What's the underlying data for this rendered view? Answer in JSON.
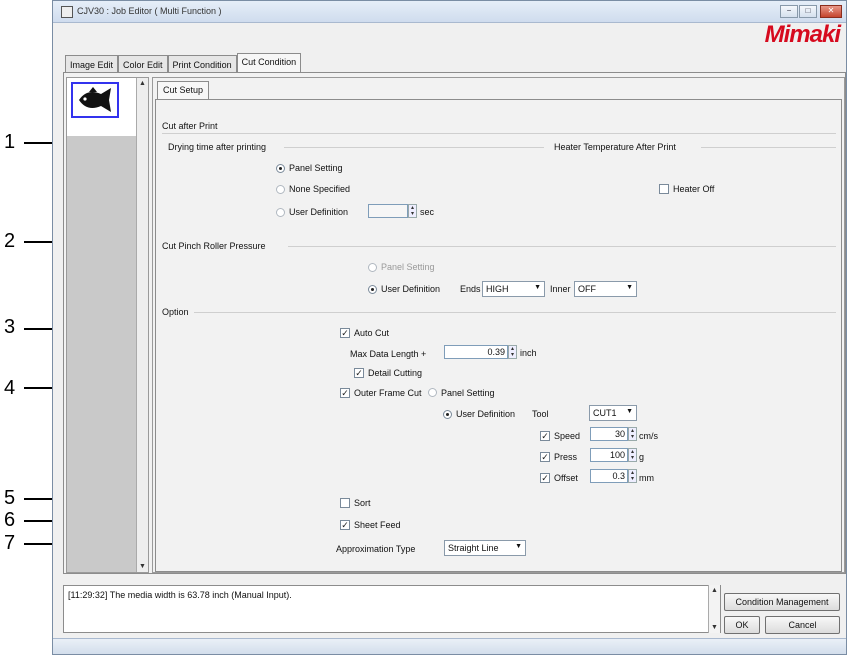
{
  "window": {
    "title": "CJV30 : Job Editor ( Multi Function )",
    "brand": "Mimaki",
    "controls": [
      "−",
      "□",
      "✕"
    ]
  },
  "tabs": [
    {
      "label": "Image Edit"
    },
    {
      "label": "Color Edit"
    },
    {
      "label": "Print Condition"
    },
    {
      "label": "Cut Condition",
      "active": true
    }
  ],
  "subtab": {
    "label": "Cut Setup"
  },
  "cut_after_print": {
    "heading": "Cut after Print",
    "drying_time_label": "Drying time after printing",
    "heater_label": "Heater Temperature After Print",
    "options": {
      "panel_setting": "Panel Setting",
      "none_specified": "None Specified",
      "user_definition": "User Definition"
    },
    "selected": "panel_setting",
    "sec_unit": "sec",
    "heater_off_label": "Heater Off",
    "heater_off_checked": false
  },
  "pinch_roller": {
    "heading": "Cut Pinch Roller Pressure",
    "panel_setting": "Panel Setting",
    "user_definition": "User Definition",
    "selected": "user_definition",
    "ends_label": "Ends",
    "ends_value": "HIGH",
    "inner_label": "Inner",
    "inner_value": "OFF"
  },
  "option": {
    "heading": "Option",
    "auto_cut": {
      "label": "Auto Cut",
      "checked": true
    },
    "max_data_length": {
      "label": "Max Data Length +",
      "value": "0.39",
      "unit": "inch"
    },
    "detail_cutting": {
      "label": "Detail Cutting",
      "checked": true
    },
    "outer_frame_cut": {
      "label": "Outer Frame Cut",
      "checked": true
    },
    "outer_panel_setting": "Panel Setting",
    "outer_user_definition": "User Definition",
    "outer_selected": "user_definition",
    "tool_label": "Tool",
    "tool_value": "CUT1",
    "speed": {
      "label": "Speed",
      "value": "30",
      "unit": "cm/s",
      "checked": true
    },
    "press": {
      "label": "Press",
      "value": "100",
      "unit": "g",
      "checked": true
    },
    "offset": {
      "label": "Offset",
      "value": "0.3",
      "unit": "mm",
      "checked": true
    },
    "sort": {
      "label": "Sort",
      "checked": false
    },
    "sheet_feed": {
      "label": "Sheet Feed",
      "checked": true
    },
    "approximation_label": "Approximation Type",
    "approximation_value": "Straight Line"
  },
  "log": {
    "message": "[11:29:32] The media width is 63.78 inch (Manual Input)."
  },
  "buttons": {
    "condition_management": "Condition Management",
    "ok": "OK",
    "cancel": "Cancel"
  },
  "callouts": [
    "1",
    "2",
    "3",
    "4",
    "5",
    "6",
    "7"
  ]
}
